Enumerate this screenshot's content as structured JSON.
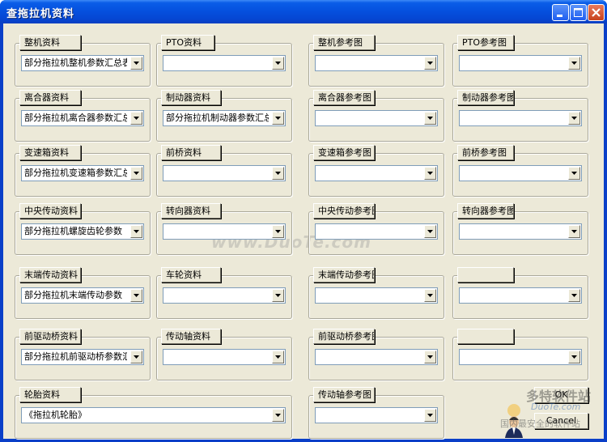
{
  "window": {
    "title": "查拖拉机资料"
  },
  "panels": [
    {
      "label": "整机资料",
      "value": "部分拖拉机整机参数汇总表"
    },
    {
      "label": "PTO资料",
      "value": ""
    },
    {
      "label": "整机参考图",
      "value": ""
    },
    {
      "label": "PTO参考图",
      "value": ""
    },
    {
      "label": "离合器资料",
      "value": "部分拖拉机离合器参数汇总"
    },
    {
      "label": "制动器资料",
      "value": "部分拖拉机制动器参数汇总"
    },
    {
      "label": "离合器参考图",
      "value": ""
    },
    {
      "label": "制动器参考图",
      "value": ""
    },
    {
      "label": "变速箱资料",
      "value": "部分拖拉机变速箱参数汇总"
    },
    {
      "label": "前桥资料",
      "value": ""
    },
    {
      "label": "变速箱参考图",
      "value": ""
    },
    {
      "label": "前桥参考图",
      "value": ""
    },
    {
      "label": "中央传动资料",
      "value": "部分拖拉机螺旋齿轮参数"
    },
    {
      "label": "转向器资料",
      "value": ""
    },
    {
      "label": "中央传动参考图",
      "value": ""
    },
    {
      "label": "转向器参考图",
      "value": ""
    },
    {
      "label": "末端传动资料",
      "value": "部分拖拉机末端传动参数"
    },
    {
      "label": "车轮资料",
      "value": ""
    },
    {
      "label": "末端传动参考图",
      "value": ""
    },
    {
      "label": "",
      "value": ""
    },
    {
      "label": "前驱动桥资料",
      "value": "部分拖拉机前驱动桥参数汇"
    },
    {
      "label": "传动轴资料",
      "value": ""
    },
    {
      "label": "前驱动桥参考图",
      "value": ""
    },
    {
      "label": "",
      "value": ""
    },
    {
      "label": "轮胎资料",
      "value": "《拖拉机轮胎》"
    },
    {
      "label": "传动轴参考图",
      "value": ""
    }
  ],
  "buttons": {
    "ok": "OK",
    "cancel": "Cancel"
  },
  "watermark": "www.DuoTe.com",
  "logo": {
    "site": "多特软件站",
    "domain": "DuoTe.com",
    "slogan": "国内最安全的软件站"
  },
  "icons": {
    "minimize": "minimize-icon",
    "maximize": "maximize-icon",
    "close": "close-icon",
    "dropdown": "chevron-down-icon"
  },
  "colors": {
    "titlebar": "#0551df",
    "client": "#ece9d8",
    "close_button": "#c7421c"
  }
}
